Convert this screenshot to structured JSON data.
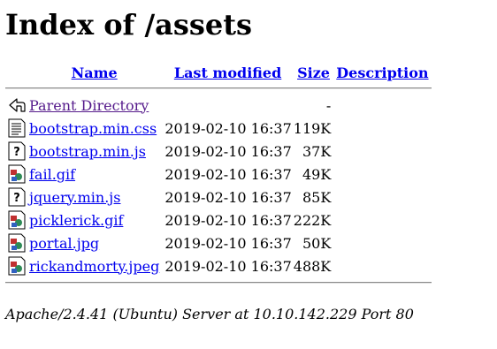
{
  "page_title": "Index of /assets",
  "columns": {
    "name": "Name",
    "last_modified": "Last modified",
    "size": "Size",
    "description": "Description"
  },
  "parent": {
    "name": "Parent Directory",
    "size": "-",
    "icon": "back-icon"
  },
  "files": [
    {
      "name": "bootstrap.min.css",
      "modified": "2019-02-10 16:37",
      "size": "119K",
      "icon": "text-icon"
    },
    {
      "name": "bootstrap.min.js",
      "modified": "2019-02-10 16:37",
      "size": "37K",
      "icon": "unknown-icon"
    },
    {
      "name": "fail.gif",
      "modified": "2019-02-10 16:37",
      "size": "49K",
      "icon": "image-icon"
    },
    {
      "name": "jquery.min.js",
      "modified": "2019-02-10 16:37",
      "size": "85K",
      "icon": "unknown-icon"
    },
    {
      "name": "picklerick.gif",
      "modified": "2019-02-10 16:37",
      "size": "222K",
      "icon": "image-icon"
    },
    {
      "name": "portal.jpg",
      "modified": "2019-02-10 16:37",
      "size": "50K",
      "icon": "image-icon"
    },
    {
      "name": "rickandmorty.jpeg",
      "modified": "2019-02-10 16:37",
      "size": "488K",
      "icon": "image-icon"
    }
  ],
  "footer": "Apache/2.4.41 (Ubuntu) Server at 10.10.142.229 Port 80",
  "colors": {
    "link": "#0000ee",
    "visited": "#551a8b"
  }
}
